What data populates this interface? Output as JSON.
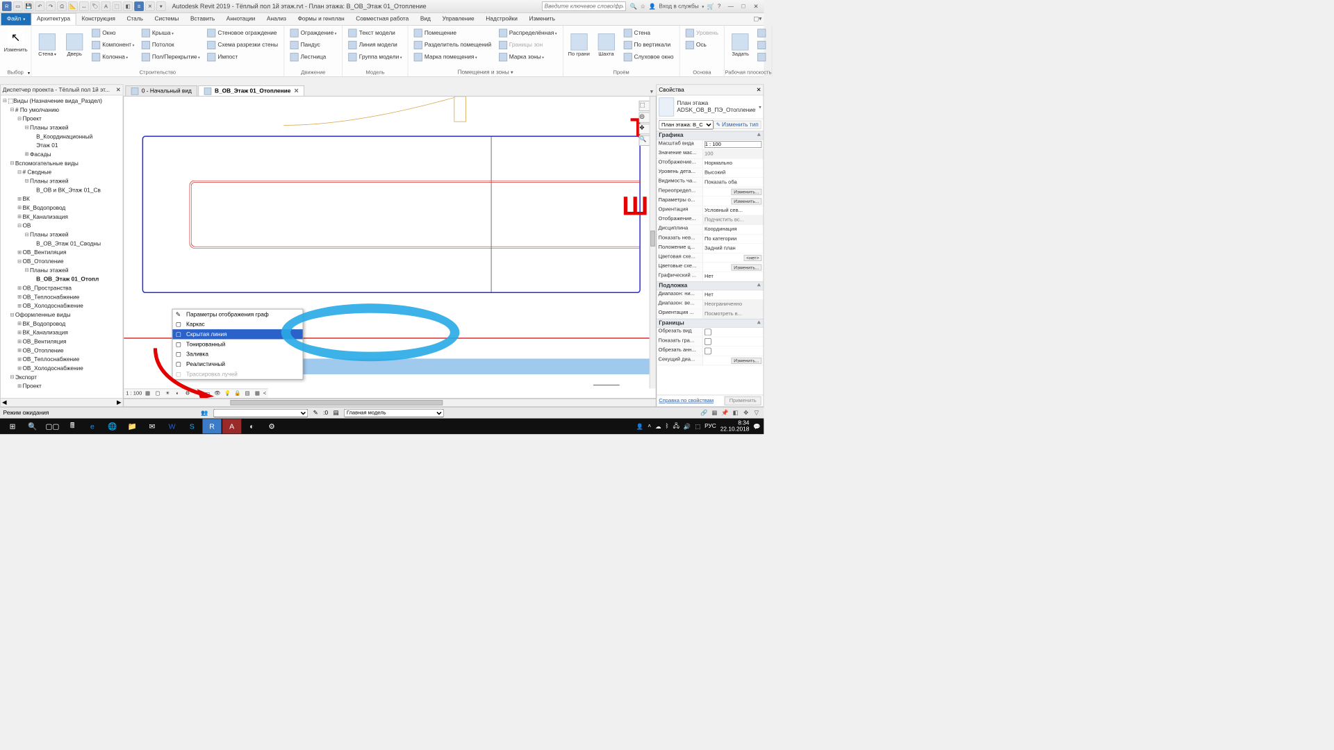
{
  "title": "Autodesk Revit 2019 - Тёплый пол 1й этаж.rvt - План этажа: В_ОВ_Этаж 01_Отопление",
  "search_placeholder": "Введите ключевое слово/фразу",
  "login": "Вход в службы",
  "menu": [
    "Файл",
    "Архитектура",
    "Конструкция",
    "Сталь",
    "Системы",
    "Вставить",
    "Аннотации",
    "Анализ",
    "Формы и генплан",
    "Совместная работа",
    "Вид",
    "Управление",
    "Надстройки",
    "Изменить"
  ],
  "menu_active": 1,
  "ribbon": {
    "p0": {
      "label": "Выбор",
      "modify": "Изменить"
    },
    "p1": {
      "label": "Строительство",
      "wall": "Стена",
      "door": "Дверь",
      "window": "Окно",
      "component": "Компонент",
      "column": "Колонна",
      "roof": "Крыша",
      "ceiling": "Потолок",
      "floor": "Пол/Перекрытие",
      "curtain_wall": "Стеновое ограждение",
      "curtain_grid": "Схема разрезки стены",
      "mullion": "Импост"
    },
    "p2": {
      "label": "Движение",
      "railing": "Ограждение",
      "ramp": "Пандус",
      "stair": "Лестница"
    },
    "p3": {
      "label": "Модель",
      "model_text": "Текст модели",
      "model_line": "Линия  модели",
      "model_group": "Группа модели"
    },
    "p4": {
      "label": "Помещения и зоны",
      "room": "Помещение",
      "room_sep": "Разделитель помещений",
      "room_tag": "Марка помещения",
      "area": "Распределённая",
      "area_bound": "Границы зон",
      "area_tag": "Марка  зоны"
    },
    "p5": {
      "label": "Проём",
      "by_face": "По грани",
      "shaft": "Шахта",
      "wall_op": "Стена",
      "vertical": "По вертикали",
      "dormer": "Слуховое окно"
    },
    "p6": {
      "label": "Основа",
      "level": "Уровень",
      "grid": "Ось"
    },
    "p7": {
      "label": "Рабочая плоскость",
      "set": "Задать"
    }
  },
  "pb": {
    "title": "Диспетчер проекта - Тёплый пол 1й эт...",
    "root": "Виды (Назначение вида_Раздел)",
    "n": {
      "default": "# По умолчанию",
      "project": "Проект",
      "plans": "Планы этажей",
      "coord": "В_Координационный",
      "l01": "Этаж 01",
      "facades": "Фасады",
      "aux": "Вспомогательные виды",
      "svod": "# Сводные",
      "aux_plans": "Планы этажей",
      "ov_vk": "В_ОВ и ВК_Этаж 01_Св",
      "vk": "ВК",
      "vk_water": "ВК_Водопровод",
      "vk_sewer": "ВК_Канализация",
      "ov": "ОВ",
      "ov_plans": "Планы этажей",
      "ov_l01": "В_ОВ_Этаж 01_Сводны",
      "ov_vent": "ОВ_Вентиляция",
      "ov_heat": "ОВ_Отопление",
      "ov_heat_plans": "Планы этажей",
      "ov_heat_cur": "В_ОВ_Этаж 01_Отопл",
      "ov_space": "ОВ_Пространства",
      "ov_ts": "ОВ_Теплоснабжение",
      "ov_cold": "ОВ_Холодоснабжение",
      "design": "Оформленные виды",
      "d_vk_w": "ВК_Водопровод",
      "d_vk_s": "ВК_Канализация",
      "d_ov_v": "ОВ_Вентиляция",
      "d_ov_h": "ОВ_Отопление",
      "d_ov_t": "ОВ_Теплоснабжение",
      "d_ov_c": "ОВ_Холодоснабжение",
      "export": "Экспорт",
      "export_proj": "Проект"
    }
  },
  "tabs": {
    "t0": "0 - Начальный вид",
    "t1": "В_ОВ_Этаж 01_Отопление"
  },
  "vcb_scale": "1 : 100",
  "ctx": {
    "header": "Параметры отображения граф",
    "wire": "Каркас",
    "hidden": "Скрытая линия",
    "shaded": "Тонированный",
    "unknown": "Заливка",
    "realistic": "Реалистичный",
    "ray": "Трассировка лучей"
  },
  "props": {
    "title": "Свойства",
    "type_name": "План этажа",
    "type_detail": "ADSK_ОВ_В_ПЭ_Отопление",
    "instance": "План этажа: В_С",
    "edit_type": "Изменить тип",
    "g_graphics": "Графика",
    "scale": {
      "n": "Масштаб вида",
      "v": "1 : 100"
    },
    "scale_val": {
      "n": "Значение мас...",
      "v": "100"
    },
    "display": {
      "n": "Отображение...",
      "v": "Нормально"
    },
    "detail": {
      "n": "Уровень дета...",
      "v": "Высокий"
    },
    "visibility": {
      "n": "Видимость ча...",
      "v": "Показать оба"
    },
    "override": {
      "n": "Переопредел...",
      "v": "Изменить..."
    },
    "graph_opts": {
      "n": "Параметры о...",
      "v": "Изменить..."
    },
    "orient": {
      "n": "Ориентация",
      "v": "Условный сев..."
    },
    "wall_disp": {
      "n": "Отображение...",
      "v": "Подчистить вс..."
    },
    "discipline": {
      "n": "Дисциплина",
      "v": "Координация"
    },
    "hidden": {
      "n": "Показать нев...",
      "v": "По категории"
    },
    "color_loc": {
      "n": "Положение ц...",
      "v": "Задний план"
    },
    "color_scheme": {
      "n": "Цветовая схе...",
      "v": "<нет>"
    },
    "sys_color": {
      "n": "Цветовые схе...",
      "v": "Изменить..."
    },
    "graph_style": {
      "n": "Графический ...",
      "v": "Нет"
    },
    "g_underlay": "Подложка",
    "u_bottom": {
      "n": "Диапазон: ни...",
      "v": "Нет"
    },
    "u_top": {
      "n": "Диапазон: ве...",
      "v": "Неограниченно"
    },
    "u_orient": {
      "n": "Ориентация ...",
      "v": "Посмотреть в..."
    },
    "g_extents": "Границы",
    "crop": {
      "n": "Обрезать вид"
    },
    "crop_vis": {
      "n": "Показать гра..."
    },
    "ann_crop": {
      "n": "Обрезать анн..."
    },
    "view_range": {
      "n": "Секущий диа...",
      "v": "Изменить..."
    },
    "help": "Справка по свойствам",
    "apply": "Применить"
  },
  "status": {
    "mode": "Режим ожидания",
    "sel": ":0",
    "model": "Главная модель"
  },
  "taskbar": {
    "lang": "РУС",
    "time": "8:34",
    "date": "22.10.2018"
  },
  "grid": {
    "t": "Т",
    "sh": "Ш"
  }
}
